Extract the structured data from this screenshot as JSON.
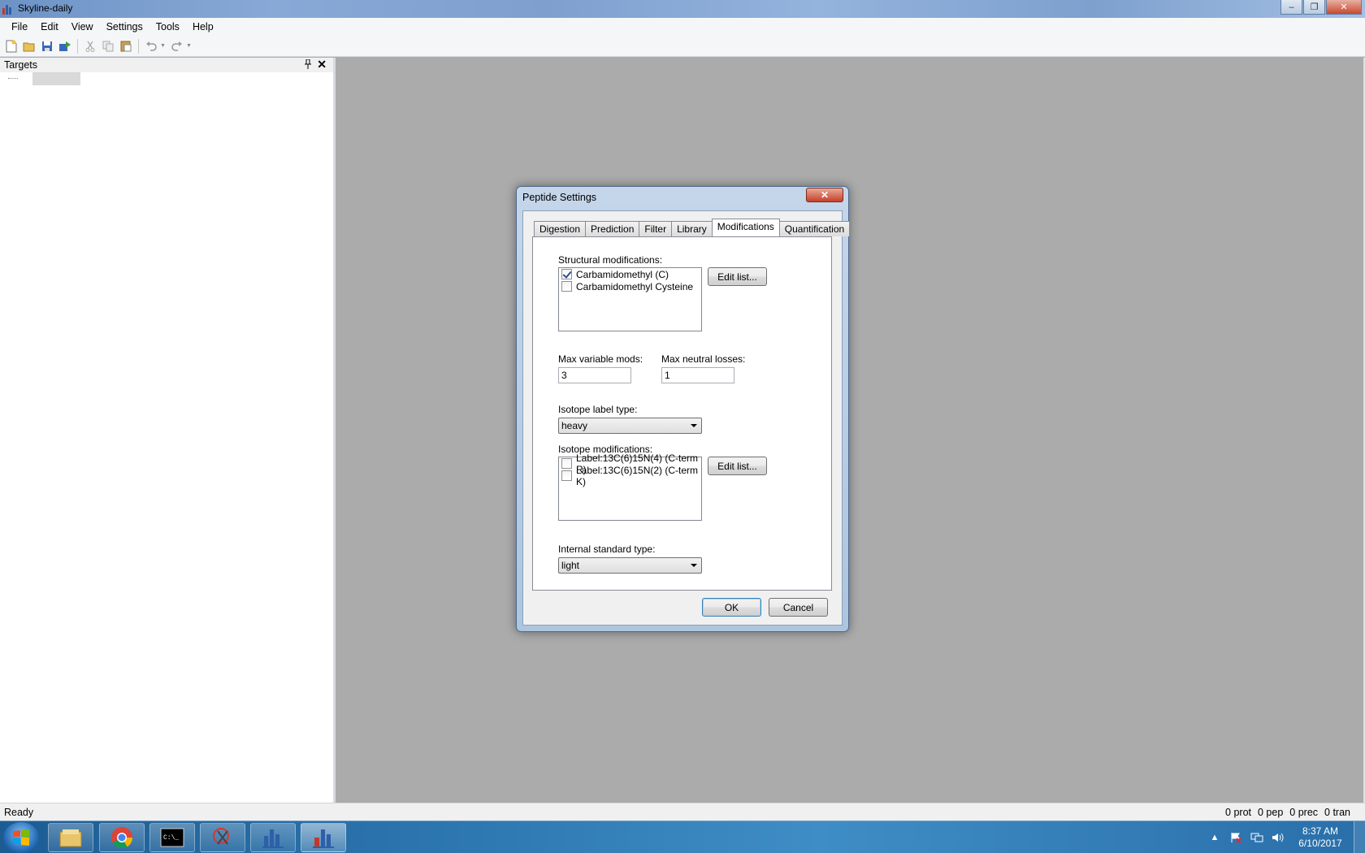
{
  "window": {
    "title": "Skyline-daily"
  },
  "menu": [
    "File",
    "Edit",
    "View",
    "Settings",
    "Tools",
    "Help"
  ],
  "targets": {
    "title": "Targets"
  },
  "status": {
    "ready": "Ready",
    "prot": "0 prot",
    "pep": "0 pep",
    "prec": "0 prec",
    "tran": "0 tran"
  },
  "clock": {
    "time": "8:37 AM",
    "date": "6/10/2017"
  },
  "dialog": {
    "title": "Peptide Settings",
    "tabs": [
      "Digestion",
      "Prediction",
      "Filter",
      "Library",
      "Modifications",
      "Quantification"
    ],
    "active_tab": "Modifications",
    "structural_label": "Structural modifications:",
    "structural_items": [
      {
        "label": "Carbamidomethyl (C)",
        "checked": true
      },
      {
        "label": "Carbamidomethyl Cysteine",
        "checked": false
      }
    ],
    "edit_list_label": "Edit list...",
    "max_variable_label": "Max variable mods:",
    "max_variable_value": "3",
    "max_neutral_label": "Max neutral losses:",
    "max_neutral_value": "1",
    "isotope_type_label": "Isotope label type:",
    "isotope_type_value": "heavy",
    "isotope_mods_label": "Isotope modifications:",
    "isotope_items": [
      {
        "label": "Label:13C(6)15N(4) (C-term R)",
        "checked": false
      },
      {
        "label": "Label:13C(6)15N(2) (C-term K)",
        "checked": false
      }
    ],
    "internal_standard_label": "Internal standard type:",
    "internal_standard_value": "light",
    "ok_label": "OK",
    "cancel_label": "Cancel"
  }
}
